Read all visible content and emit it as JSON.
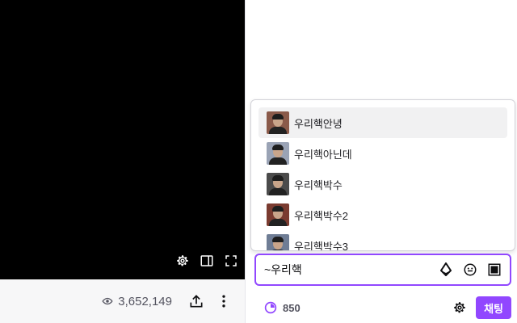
{
  "player": {
    "controls": [
      {
        "icon": "gear-icon"
      },
      {
        "icon": "theatre-mode-icon"
      },
      {
        "icon": "fullscreen-icon"
      }
    ]
  },
  "stream_info": {
    "viewer_count": "3,652,149",
    "viewer_icon": "eye-icon",
    "share_icon": "share-icon",
    "more_icon": "more-vertical-icon"
  },
  "autocomplete": {
    "items": [
      {
        "label": "우리핵안녕",
        "thumb_bg": "#8a5a4a",
        "selected": true
      },
      {
        "label": "우리핵아닌데",
        "thumb_bg": "#9aa3b5",
        "selected": false
      },
      {
        "label": "우리핵박수",
        "thumb_bg": "#4b4b4b",
        "selected": false
      },
      {
        "label": "우리핵박수2",
        "thumb_bg": "#7a3b30",
        "selected": false
      },
      {
        "label": "우리핵박수3",
        "thumb_bg": "#6f7d95",
        "selected": false
      }
    ]
  },
  "chat_input": {
    "value": "~우리핵",
    "icons": [
      "bits-icon",
      "emote-icon",
      "emote-picker-icon"
    ]
  },
  "footer": {
    "points": "850",
    "points_icon": "channel-points-icon",
    "settings_icon": "gear-icon",
    "send_label": "채팅"
  },
  "colors": {
    "accent": "#9147ff",
    "player_bg": "#000000",
    "bar_bg": "#f7f7f8"
  }
}
